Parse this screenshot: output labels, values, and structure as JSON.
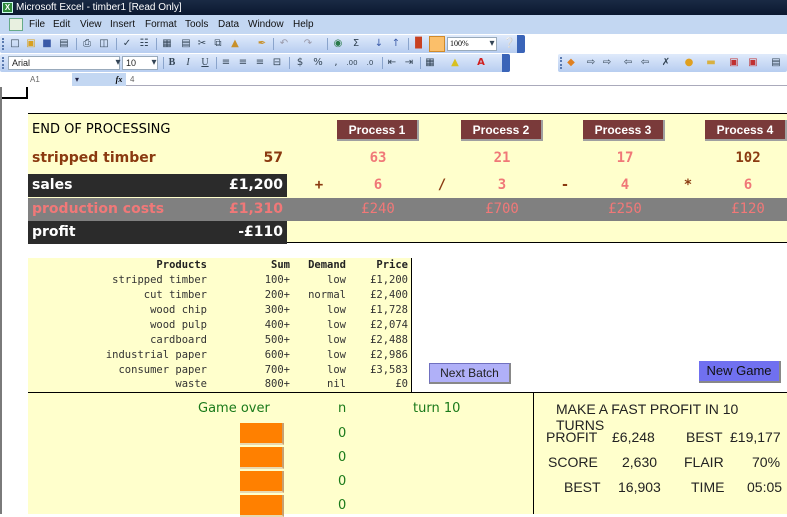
{
  "window": {
    "title": "Microsoft Excel - timber1 [Read Only]"
  },
  "menu": [
    "File",
    "Edit",
    "View",
    "Insert",
    "Format",
    "Tools",
    "Data",
    "Window",
    "Help"
  ],
  "toolbar": {
    "font": "Arial",
    "font_size": "10",
    "zoom": "100%",
    "bold": "B",
    "italic": "I",
    "underline": "U",
    "currency": "$",
    "percent": "%"
  },
  "formula_bar": {
    "name_box": "A1",
    "fx": "fx",
    "value": "4"
  },
  "processing": {
    "title": "END OF PROCESSING",
    "process_buttons": [
      "Process 1",
      "Process 2",
      "Process 3",
      "Process 4"
    ],
    "stripped_timber": {
      "label": "stripped timber",
      "value": "57",
      "process_values": [
        "63",
        "21",
        "17",
        "102"
      ]
    },
    "sales": {
      "label": "sales",
      "value": "£1,200",
      "operators": [
        "+",
        "/",
        "-",
        "*"
      ],
      "process_values": [
        "6",
        "3",
        "4",
        "6"
      ]
    },
    "production_costs": {
      "label": "production costs",
      "value": "£1,310",
      "process_values": [
        "£240",
        "£700",
        "£250",
        "£120"
      ]
    },
    "profit": {
      "label": "profit",
      "value": "-£110"
    }
  },
  "products_table": {
    "headers": [
      "Products",
      "Sum",
      "Demand",
      "Price"
    ],
    "rows": [
      [
        "stripped timber",
        "100+",
        "low",
        "£1,200"
      ],
      [
        "cut timber",
        "200+",
        "normal",
        "£2,400"
      ],
      [
        "wood chip",
        "300+",
        "low",
        "£1,728"
      ],
      [
        "wood pulp",
        "400+",
        "low",
        "£2,074"
      ],
      [
        "cardboard",
        "500+",
        "low",
        "£2,488"
      ],
      [
        "industrial paper",
        "600+",
        "low",
        "£2,986"
      ],
      [
        "consumer paper",
        "700+",
        "low",
        "£3,583"
      ],
      [
        "waste",
        "800+",
        "nil",
        "£0"
      ]
    ]
  },
  "buttons": {
    "next_batch": "Next Batch",
    "new_game": "New Game"
  },
  "game": {
    "status": "Game over",
    "n_label": "n",
    "turn": "turn 10",
    "counts": [
      "0",
      "0",
      "0",
      "0"
    ]
  },
  "score": {
    "title": "MAKE A FAST PROFIT IN 10 TURNS",
    "profit_label": "PROFIT",
    "profit": "£6,248",
    "best_profit_label": "BEST",
    "best_profit": "£19,177",
    "score_label": "SCORE",
    "score": "2,630",
    "flair_label": "FLAIR",
    "flair": "70%",
    "best_score_label": "BEST",
    "best_score": "16,903",
    "time_label": "TIME",
    "time": "05:05"
  },
  "colors": {
    "panel_bg": "#ffffcc",
    "process_button": "#7a3a3a",
    "dark_row": "#2b2b2b",
    "cost_band": "#808080",
    "salmon": "#f07878",
    "brown": "#8a3a10",
    "green": "#1a7a1a",
    "orange": "#ff8000"
  }
}
